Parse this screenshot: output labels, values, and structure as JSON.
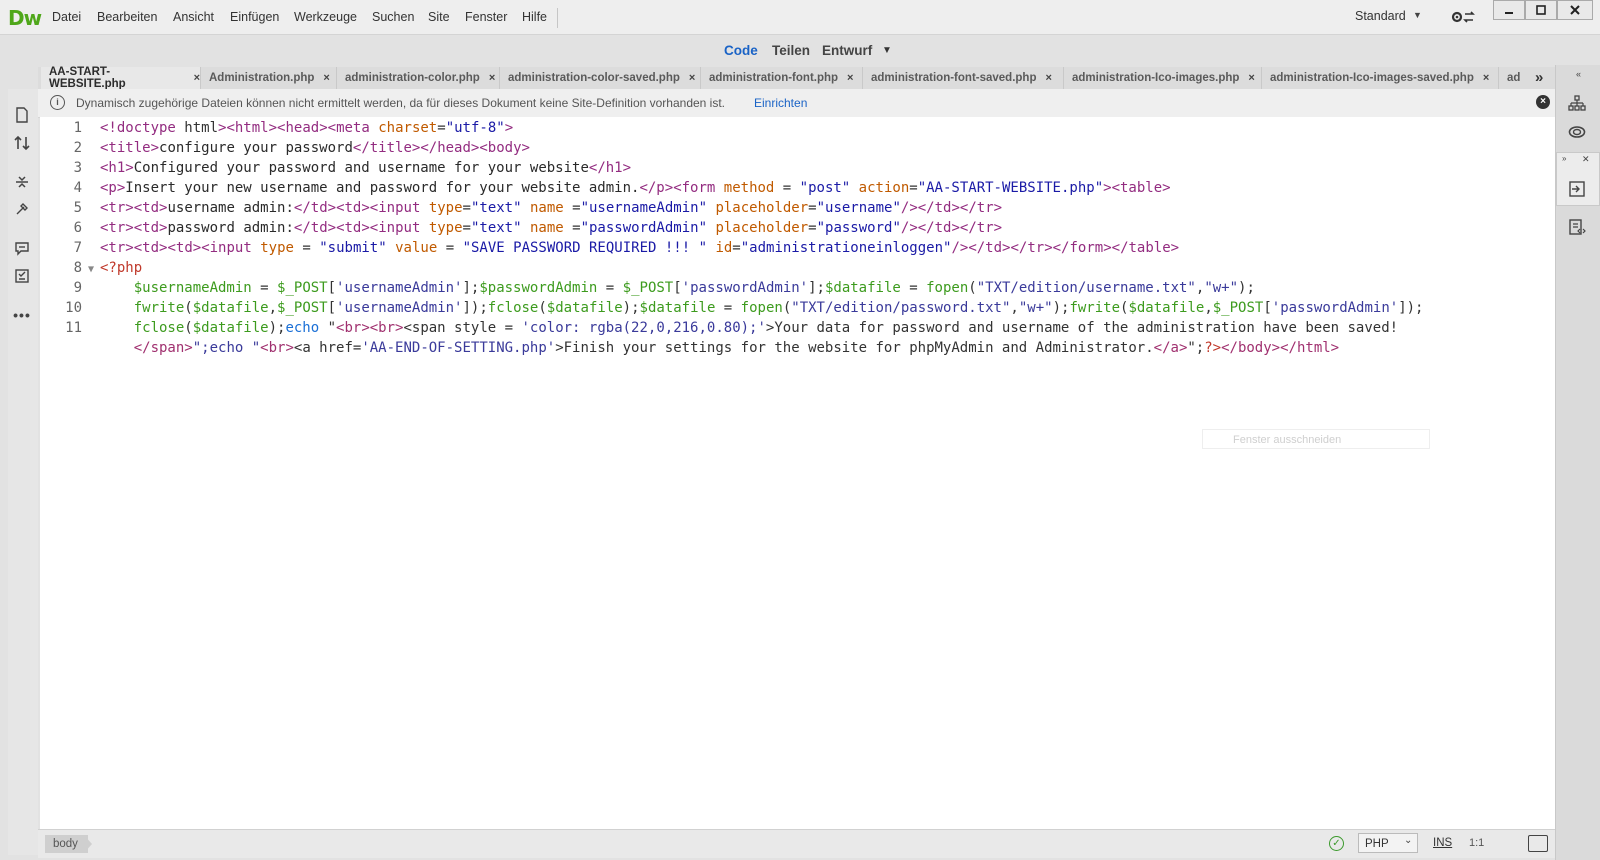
{
  "app": {
    "logo": "Dw"
  },
  "menu": {
    "items": [
      "Datei",
      "Bearbeiten",
      "Ansicht",
      "Einfügen",
      "Werkzeuge",
      "Suchen",
      "Site",
      "Fenster",
      "Hilfe"
    ],
    "workspace": "Standard"
  },
  "views": {
    "code": "Code",
    "split": "Teilen",
    "design": "Entwurf"
  },
  "colors": {
    "accent": "#1a63c6",
    "logo": "#4fa71a"
  },
  "tabs": [
    {
      "label": "AA-START-WEBSITE.php",
      "active": true
    },
    {
      "label": "Administration.php"
    },
    {
      "label": "administration-color.php"
    },
    {
      "label": "administration-color-saved.php"
    },
    {
      "label": "administration-font.php"
    },
    {
      "label": "administration-font-saved.php"
    },
    {
      "label": "administration-Ico-images.php"
    },
    {
      "label": "administration-Ico-images-saved.php"
    },
    {
      "label": "ad"
    }
  ],
  "tab_close": "×",
  "tab_overflow": "»",
  "infobar": {
    "text": "Dynamisch zugehörige Dateien können nicht ermittelt werden, da für dieses Dokument keine Site-Definition vorhanden ist.",
    "link": "Einrichten"
  },
  "code": {
    "line_numbers": [
      "1",
      "2",
      "3",
      "4",
      "5",
      "6",
      "7",
      "8",
      "9",
      "10",
      "11"
    ],
    "lines": [
      "<!doctype html><html><head><meta charset=\"utf-8\">",
      "<title>configure your password</title></head><body>",
      "<h1>Configured your password and username for your website</h1>",
      "<p>Insert your new username and password for your website admin.</p><form method = \"post\" action=\"AA-START-WEBSITE.php\"><table>",
      "<tr><td>username admin:</td><td><input type=\"text\" name =\"usernameAdmin\" placeholder=\"username\"/></td></tr>",
      "<tr><td>password admin:</td><td><input type=\"text\" name =\"passwordAdmin\" placeholder=\"password\"/></td></tr>",
      "<tr><td><td><input type = \"submit\" value = \"SAVE PASSWORD REQUIRED !!! \" id=\"administrationeinloggen\"/></td></tr></form></table>",
      "<?php",
      "    $usernameAdmin = $_POST['usernameAdmin'];$passwordAdmin = $_POST['passwordAdmin'];$datafile = fopen(\"TXT/edition/username.txt\",\"w+\");",
      "    fwrite($datafile,$_POST['usernameAdmin']);fclose($datafile);$datafile = fopen(\"TXT/edition/password.txt\",\"w+\");fwrite($datafile,$_POST['passwordAdmin']);",
      "    fclose($datafile);echo \"<br><br><span style = 'color: rgba(22,0,216,0.80);'>Your data for password and username of the administration have been saved!",
      "    </span>\";echo \"<br><a href='AA-END-OF-SETTING.php'>Finish your settings for the website for phpMyAdmin and Administrator.</a>\";?></body></html>"
    ]
  },
  "ghost_tooltip": "Fenster ausschneiden",
  "status": {
    "tag": "body",
    "language": "PHP",
    "mode": "INS",
    "position": "1:1"
  }
}
